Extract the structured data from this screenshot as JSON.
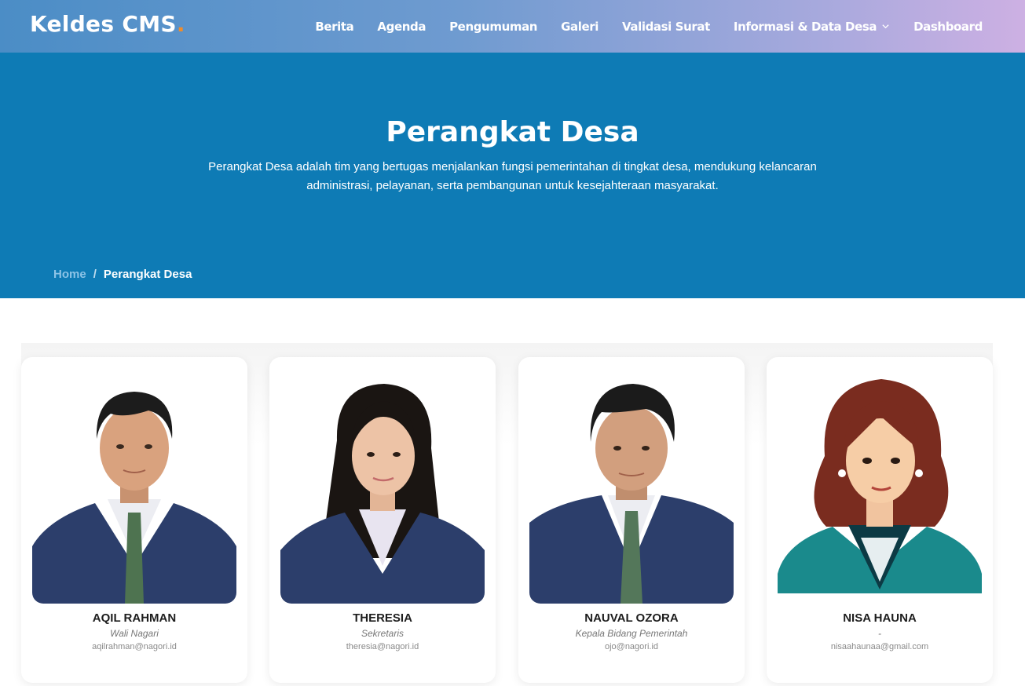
{
  "brand": {
    "name": "Keldes CMS",
    "dot": ".",
    "dot_color": "#f08c2a"
  },
  "nav": {
    "items": [
      {
        "label": "Berita"
      },
      {
        "label": "Agenda"
      },
      {
        "label": "Pengumuman"
      },
      {
        "label": "Galeri"
      },
      {
        "label": "Validasi Surat"
      },
      {
        "label": "Informasi & Data Desa",
        "icon": "chevron-down-icon"
      },
      {
        "label": "Dashboard"
      }
    ]
  },
  "hero": {
    "title": "Perangkat Desa",
    "description": "Perangkat Desa adalah tim yang bertugas menjalankan fungsi pemerintahan di tingkat desa, mendukung kelancaran administrasi, pelayanan, serta pembangunan untuk kesejahteraan masyarakat.",
    "background": "#0e7bb5"
  },
  "breadcrumb": {
    "home": "Home",
    "separator": "/",
    "current": "Perangkat Desa"
  },
  "team": [
    {
      "name": "AQIL RAHMAN",
      "role": "Wali Nagari",
      "email": "aqilrahman@nagori.id",
      "photo": "male-portrait"
    },
    {
      "name": "THERESIA",
      "role": "Sekretaris",
      "email": "theresia@nagori.id",
      "photo": "female-portrait"
    },
    {
      "name": "NAUVAL OZORA",
      "role": "Kepala Bidang Pemerintah",
      "email": "ojo@nagori.id",
      "photo": "male-portrait"
    },
    {
      "name": "NISA HAUNA",
      "role": "-",
      "email": "nisaahaunaa@gmail.com",
      "photo": "female-avatar-illustration"
    }
  ]
}
